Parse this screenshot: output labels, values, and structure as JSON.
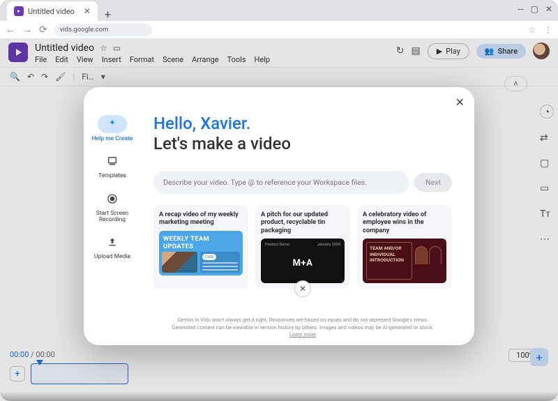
{
  "browser": {
    "tab_title": "Untitled video",
    "url": "vids.google.com"
  },
  "app": {
    "doc_title": "Untitled video",
    "menu": [
      "File",
      "Edit",
      "View",
      "Insert",
      "Format",
      "Scene",
      "Arrange",
      "Tools",
      "Help"
    ],
    "play_label": "Play",
    "share_label": "Share"
  },
  "timeline": {
    "current": "00:00",
    "total": "00:00",
    "zoom": "100%"
  },
  "modal": {
    "greeting_hello": "Hello, Xavier.",
    "greeting_make": "Let's make a video",
    "prompt_placeholder": "Describe your video. Type @ to reference your Workspace files.",
    "next_label": "Next",
    "rail": {
      "help_me_create": "Help me Create",
      "templates": "Templates",
      "start_recording": "Start Screen Recording",
      "upload_media": "Upload Media"
    },
    "suggestions": [
      {
        "title": "A recap video of my weekly marketing meeting",
        "banner": "WEEKLY TEAM UPDATES",
        "pill": "Date"
      },
      {
        "title": "A pitch for our updated product, recyclable tin packaging",
        "tag_left": "Product Demo",
        "tag_right": "January 2024",
        "logo": "M+A"
      },
      {
        "title": "A celebratory video of employee wins in the company",
        "headline": "TEAM AND/OR INDIVIDUAL INTRODUCTION"
      }
    ],
    "disclaimer": "Gemini in Vids won't always get it right. Responses are based on inputs and do not represent Google's views. Generated content can be viewable in version history by others. Images and videos may be AI-generated or stock.",
    "disclaimer_link": "Learn more"
  }
}
